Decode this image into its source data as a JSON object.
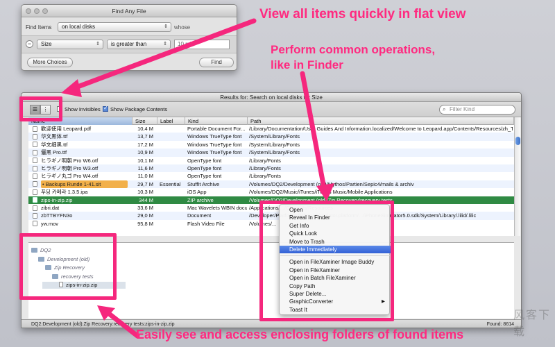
{
  "find_dialog": {
    "title": "Find Any File",
    "find_items_label": "Find Items",
    "location_value": "on local disks",
    "whose_label": "whose",
    "remove_glyph": "−",
    "attribute_value": "Size",
    "operator_value": "is greater than",
    "value_field": "10 mb",
    "more_choices_label": "More Choices",
    "find_label": "Find"
  },
  "results_window": {
    "title": "Results for: Search on local disks for Size",
    "show_invisibles_label": "Show Invisibles",
    "show_package_contents_label": "Show Package Contents",
    "filter_placeholder": "Filter Kind",
    "columns": {
      "name": "Name",
      "size": "Size",
      "label": "Label",
      "kind": "Kind",
      "path": "Path"
    },
    "rows": [
      {
        "name": "歡迎使用 Leopard.pdf",
        "size": "10,4 M",
        "label": "",
        "kind": "Portable Document For...",
        "path": "/Library/Documentation/User Guides And Information.localized/Welcome to Leopard.app/Contents/Resources/zh_TW.lproj"
      },
      {
        "name": "华文黑体.ttf",
        "size": "13,7 M",
        "label": "",
        "kind": "Windows TrueType font",
        "path": "/System/Library/Fonts"
      },
      {
        "name": "华文细黑.ttf",
        "size": "17,2 M",
        "label": "",
        "kind": "Windows TrueType font",
        "path": "/System/Library/Fonts"
      },
      {
        "name": "儷黑 Pro.ttf",
        "size": "10,9 M",
        "label": "",
        "kind": "Windows TrueType font",
        "path": "/System/Library/Fonts"
      },
      {
        "name": "ヒラギノ明朝 Pro W6.otf",
        "size": "10,1 M",
        "label": "",
        "kind": "OpenType font",
        "path": "/Library/Fonts"
      },
      {
        "name": "ヒラギノ明朝 Pro W3.otf",
        "size": "11,6 M",
        "label": "",
        "kind": "OpenType font",
        "path": "/Library/Fonts"
      },
      {
        "name": "ヒラギノ丸ゴ Pro W4.otf",
        "size": "11,0 M",
        "label": "",
        "kind": "OpenType font",
        "path": "/Library/Fonts"
      },
      {
        "name": "• Backups Runde 1-41.sit",
        "size": "29,7 M",
        "label": "Essential",
        "kind": "StuffIt Archive",
        "path": "/Volumes/DQ2/Development (old)/Mythos/Partien/Sepic4/mails & archiv"
      },
      {
        "name": "푸딩 카메라 1.3.5.ipa",
        "size": "10,3 M",
        "label": "",
        "kind": "iOS App",
        "path": "/Volumes/DQ2/Music/iTunes/iTunes Music/Mobile Applications"
      },
      {
        "name": "zips-in-zip.zip",
        "size": "344 M",
        "label": "",
        "kind": "ZIP archive",
        "path": "/Volumes/DQ2/Development (old)/Zip Recovery/recovery tests"
      },
      {
        "name": "zibri.dat",
        "size": "33,6 M",
        "label": "",
        "kind": "Mac Wavelets WBIN docu...",
        "path": "/Applications/.../Contents/Resources"
      },
      {
        "name": "zbTTBYFN3o",
        "size": "29,0 M",
        "label": "",
        "kind": "Document",
        "path": "/Developer/Platforms/iPhoneSimulator.platform/.../iPhoneSimulator5.0.sdk/System/Library/.lilid/.lilic"
      },
      {
        "name": "yw.mov",
        "size": "95,8 M",
        "label": "",
        "kind": "Flash Video File",
        "path": "/Volumes/..."
      }
    ],
    "enclosing_folders": [
      {
        "label": "DQ2",
        "level": 0
      },
      {
        "label": "Development (old)",
        "level": 1
      },
      {
        "label": "Zip Recovery",
        "level": 2
      },
      {
        "label": "recovery tests",
        "level": 3
      },
      {
        "label": "zips-in-zip.zip",
        "level": 4
      }
    ],
    "status_path": "DQ2:Development (old):Zip Recovery:recovery tests:zips-in-zip.zip",
    "found_count": "Found: 8614"
  },
  "context_menu": {
    "items": [
      {
        "label": "Open"
      },
      {
        "label": "Reveal In Finder"
      },
      {
        "label": "Get Info"
      },
      {
        "label": "Quick Look"
      },
      {
        "label": "Move to Trash"
      },
      {
        "label": "Delete Immediately",
        "highlighted": true
      },
      {
        "label": "Open in FileXaminer Image Buddy"
      },
      {
        "label": "Open in FileXaminer"
      },
      {
        "label": "Open in Batch FileXaminer"
      },
      {
        "label": "Copy Path"
      },
      {
        "label": "Super Delete..."
      },
      {
        "label": "GraphicConverter",
        "submenu": true
      },
      {
        "label": "Toast It"
      }
    ],
    "submenu_glyph": "▶"
  },
  "annotations": {
    "flat_view": "View all items quickly in flat view",
    "common_ops_line1": "Perform common operations,",
    "common_ops_line2": "like in Finder",
    "enclosing": "Easily see and access enclosing folders of found items"
  },
  "watermark": "风客下载",
  "colors": {
    "annotation": "#f5277d",
    "annotation_text": "#ff2a80",
    "selected_row": "#2f8a43",
    "menu_highlight": "#3361d6"
  }
}
